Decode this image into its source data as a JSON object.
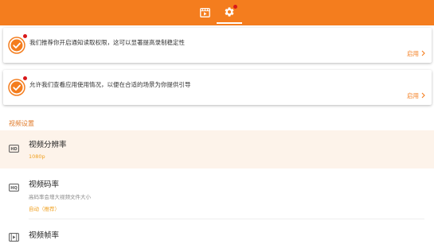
{
  "colors": {
    "accent": "#f47d1e",
    "badge": "#d8181a",
    "highlight_row": "#fdf3ea"
  },
  "top_tabs": [
    {
      "icon": "video-list-icon",
      "selected": false
    },
    {
      "icon": "gear-icon",
      "selected": true,
      "badge": true
    }
  ],
  "permission_cards": [
    {
      "icon": "check-circle-icon",
      "text": "我们推荐你开启通知读取权限，这可以显著提高录制稳定性",
      "action": "启用"
    },
    {
      "icon": "check-circle-icon",
      "text": "允许我们查看应用使用情况，以便在合适的场景为你提供引导",
      "action": "启用"
    }
  ],
  "section_title": "视频设置",
  "settings": [
    {
      "icon": "hd-icon",
      "icon_text": "HD",
      "title": "视频分辨率",
      "value": "1080p"
    },
    {
      "icon": "bitrate-icon",
      "icon_text": "HQ",
      "title": "视频码率",
      "subtitle": "高码率会增大视频文件大小",
      "value": "自动（推荐）"
    },
    {
      "icon": "framerate-icon",
      "title": "视频帧率"
    }
  ]
}
